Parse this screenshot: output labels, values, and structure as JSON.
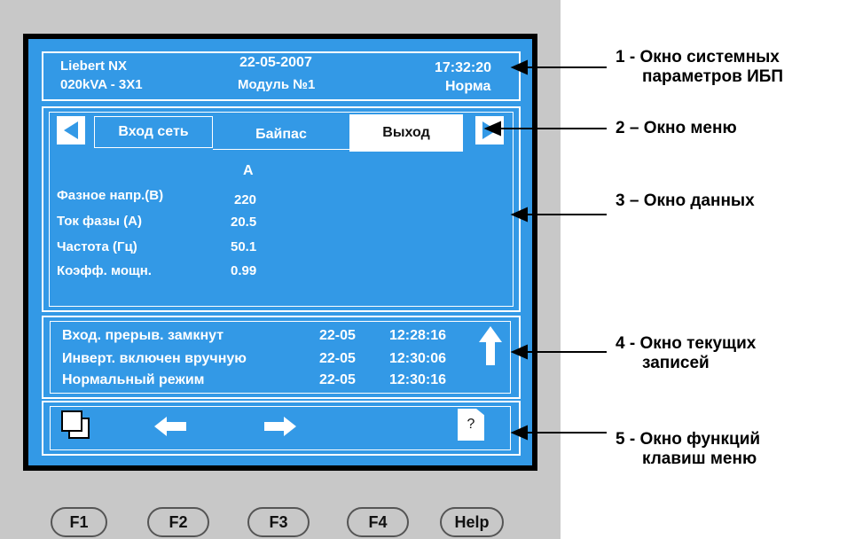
{
  "system_window": {
    "model": "Liebert  NX",
    "rating": "020kVA - 3X1",
    "date": "22-05-2007",
    "module": "Модуль №1",
    "time": "17:32:20",
    "status": "Норма"
  },
  "menu": {
    "tabs": [
      {
        "label": "Вход сеть",
        "active": false
      },
      {
        "label": "Байпас",
        "active": false
      },
      {
        "label": "Выход",
        "active": true
      }
    ],
    "left_icon": "triangle-left-icon",
    "right_icon": "triangle-right-icon"
  },
  "data_window": {
    "phase_header": "A",
    "rows": [
      {
        "label": "Фазное напр.(В)",
        "value": "220"
      },
      {
        "label": "Ток фазы (А)",
        "value": "20.5"
      },
      {
        "label": "Частота (Гц)",
        "value": "50.1"
      },
      {
        "label": "Коэфф. мощн.",
        "value": "0.99"
      }
    ]
  },
  "records_window": {
    "rows": [
      {
        "event": "Вход. прерыв. замкнут",
        "date": "22-05",
        "time": "12:28:16"
      },
      {
        "event": "Инверт. включен вручную",
        "date": "22-05",
        "time": "12:30:06"
      },
      {
        "event": "Нормальный режим",
        "date": "22-05",
        "time": "12:30:16"
      }
    ],
    "scroll_icon": "arrow-up-icon"
  },
  "function_window": {
    "icons": [
      "copy-icon",
      "arrow-left-icon",
      "arrow-right-icon",
      "help-document-icon"
    ],
    "help_glyph": "?"
  },
  "keys": [
    "F1",
    "F2",
    "F3",
    "F4",
    "Help"
  ],
  "annotations": [
    {
      "line1": "1 - Окно системных",
      "line2": "параметров ИБП"
    },
    {
      "line1": "2 – Окно меню",
      "line2": ""
    },
    {
      "line1": "3 – Окно данных",
      "line2": ""
    },
    {
      "line1": "4 - Окно текущих",
      "line2": "записей"
    },
    {
      "line1": "5 - Окно функций",
      "line2": "клавиш меню"
    }
  ],
  "colors": {
    "screen_blue": "#3399e6",
    "device_gray": "#c8c8c8",
    "text_white": "#ffffff"
  }
}
